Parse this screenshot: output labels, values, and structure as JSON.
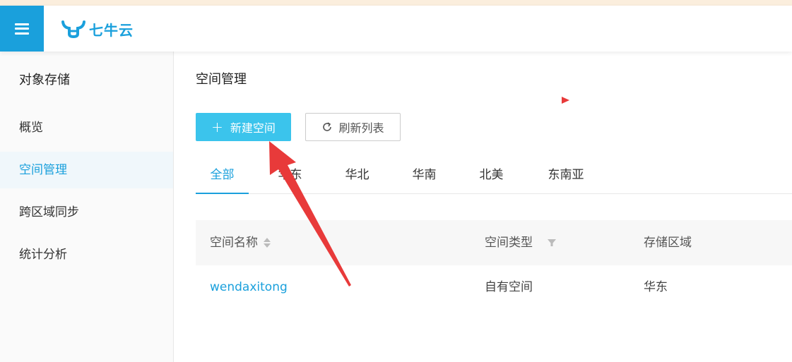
{
  "header": {
    "logo_text": "七牛云"
  },
  "sidebar": {
    "title": "对象存储",
    "items": [
      {
        "label": "概览"
      },
      {
        "label": "空间管理"
      },
      {
        "label": "跨区域同步"
      },
      {
        "label": "统计分析"
      }
    ]
  },
  "main": {
    "title": "空间管理",
    "new_bucket_label": "新建空间",
    "refresh_label": "刷新列表",
    "tabs": [
      {
        "label": "全部"
      },
      {
        "label": "华东"
      },
      {
        "label": "华北"
      },
      {
        "label": "华南"
      },
      {
        "label": "北美"
      },
      {
        "label": "东南亚"
      }
    ],
    "table": {
      "columns": [
        "空间名称",
        "空间类型",
        "存储区域"
      ],
      "rows": [
        {
          "name": "wendaxitong",
          "type": "自有空间",
          "region": "华东"
        }
      ]
    }
  },
  "colors": {
    "brand": "#1aa0dc",
    "primary_button": "#3bc4ec",
    "annotation_arrow": "#e83a3a"
  }
}
